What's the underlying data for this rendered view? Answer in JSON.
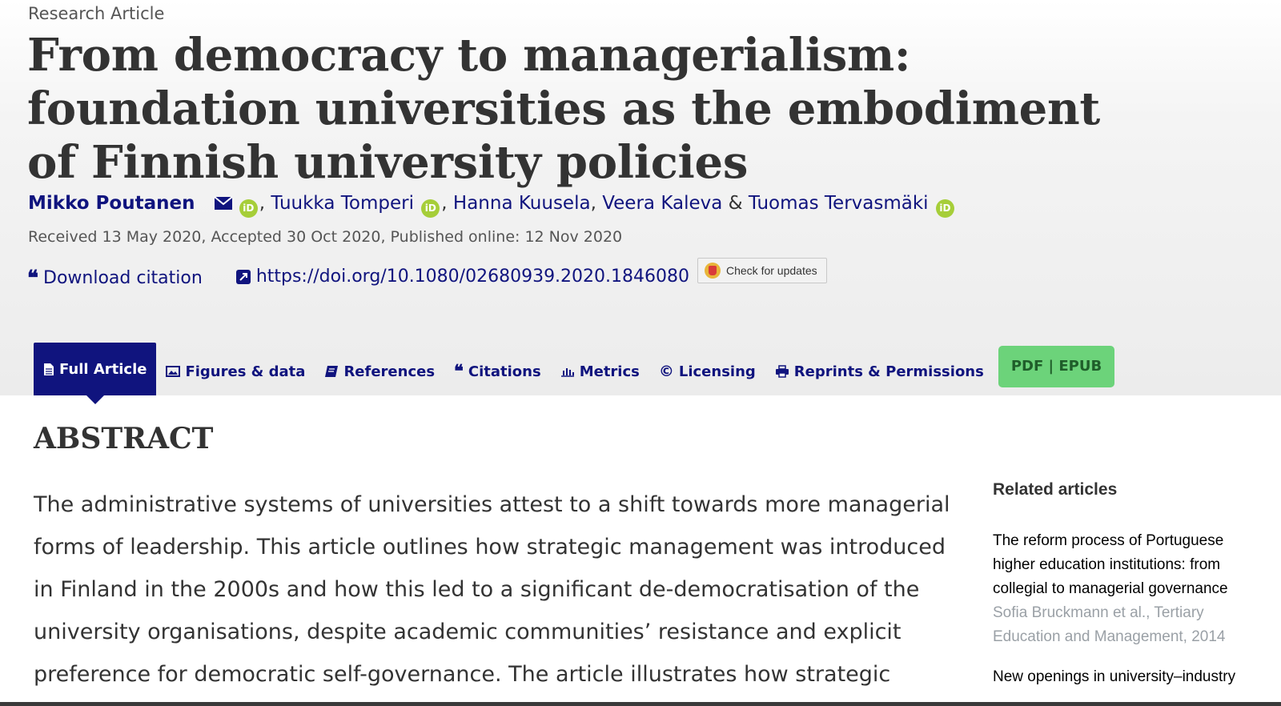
{
  "header": {
    "article_type": "Research Article",
    "title": "From democracy to managerialism: foundation universities as the embodiment of Finnish university policies",
    "authors": {
      "lead": "Mikko Poutanen",
      "a2": "Tuukka Tomperi",
      "a3": "Hanna Kuusela",
      "a4": "Veera Kaleva",
      "amp": "&",
      "a5": "Tuomas Tervasmäki",
      "comma": ","
    },
    "dates": "Received 13 May 2020, Accepted 30 Oct 2020, Published online: 12 Nov 2020",
    "download_citation": "Download citation",
    "doi": "https://doi.org/10.1080/02680939.2020.1846080",
    "check_updates": "Check for updates"
  },
  "tabs": {
    "full_article": "Full Article",
    "figures": "Figures & data",
    "references": "References",
    "citations": "Citations",
    "metrics": "Metrics",
    "licensing": "Licensing",
    "reprints": "Reprints & Permissions",
    "pdf": "PDF | EPUB"
  },
  "abstract": {
    "heading": "ABSTRACT",
    "text": "The administrative systems of universities attest to a shift towards more managerial forms of leadership. This article outlines how strategic management was introduced in Finland in the 2000s and how this led to a significant de-democratisation of the university organisations, despite academic communities’ resistance and explicit preference for democratic self-governance. The article illustrates how strategic"
  },
  "related": {
    "heading": "Related articles",
    "items": [
      {
        "title": "The reform process of Portuguese higher education institutions: from collegial to managerial governance",
        "meta": "Sofia Bruckmann et al., Tertiary Education and Management, 2014"
      },
      {
        "title": "New openings in university–industry",
        "meta": ""
      }
    ]
  },
  "colors": {
    "navy": "#10147e",
    "orcid": "#a6ce39",
    "pdf_green": "#6cd37a"
  }
}
